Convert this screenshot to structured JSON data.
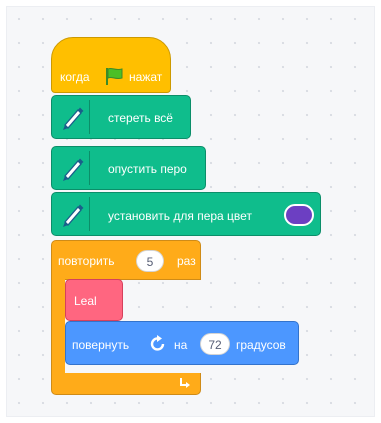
{
  "event_block": {
    "label_before": "когда",
    "label_after": "нажат",
    "icon": "green-flag-icon",
    "color": "#ffbf00"
  },
  "pen_blocks": [
    {
      "label": "стереть всё",
      "icon": "pen-icon"
    },
    {
      "label": "опустить перо",
      "icon": "pen-icon"
    },
    {
      "label": "установить для пера цвет",
      "icon": "pen-icon",
      "color_value": "#6c3fc2"
    }
  ],
  "pen_color": "#0fbd8c",
  "repeat_block": {
    "label_before": "повторить",
    "count": "5",
    "label_after": "раз",
    "color": "#ffab19"
  },
  "custom_block": {
    "label": "Leal",
    "color": "#ff6680"
  },
  "turn_block": {
    "label_before": "повернуть",
    "icon": "rotate-right-icon",
    "label_mid": "на",
    "degrees": "72",
    "label_after": "градусов",
    "color": "#4c97ff"
  }
}
